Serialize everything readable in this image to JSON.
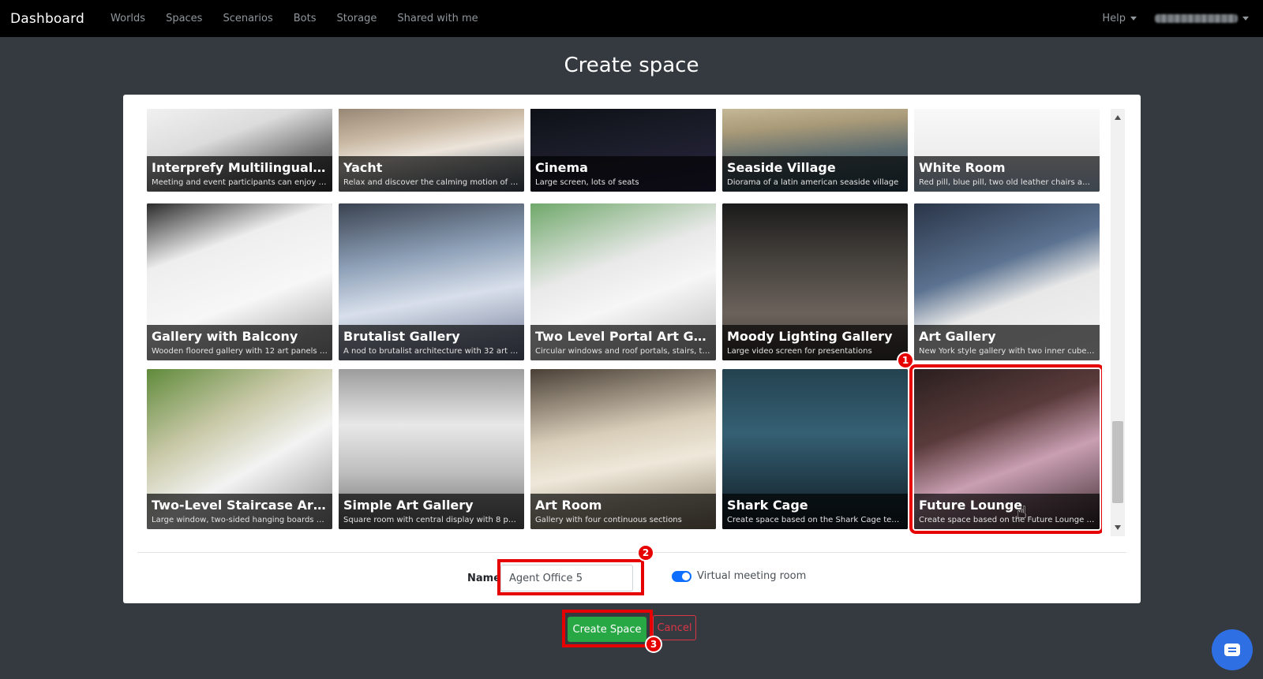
{
  "navbar": {
    "brand": "Dashboard",
    "links": [
      "Worlds",
      "Spaces",
      "Scenarios",
      "Bots",
      "Storage",
      "Shared with me"
    ],
    "help": "Help"
  },
  "page": {
    "title": "Create space"
  },
  "spaces": [
    {
      "title": "Interprefy Multilingual Con...",
      "desc": "Meeting and event participants can enjoy real-ti...",
      "thumb": "white-stage"
    },
    {
      "title": "Yacht",
      "desc": "Relax and discover the calming motion of floati...",
      "thumb": "yacht"
    },
    {
      "title": "Cinema",
      "desc": "Large screen, lots of seats",
      "thumb": "dark"
    },
    {
      "title": "Seaside Village",
      "desc": "Diorama of a latin american seaside village",
      "thumb": "seaside"
    },
    {
      "title": "White Room",
      "desc": "Red pill, blue pill, two old leather chairs and a vi...",
      "thumb": "white"
    },
    {
      "title": "Gallery with Balcony",
      "desc": "Wooden floored gallery with 12 art panels and r...",
      "thumb": "gallery-light"
    },
    {
      "title": "Brutalist Gallery",
      "desc": "A nod to brutalist architecture with 32 art panels",
      "thumb": "brutalist"
    },
    {
      "title": "Two Level Portal Art Gallery",
      "desc": "Circular windows and roof portals, stairs, two in...",
      "thumb": "portal"
    },
    {
      "title": "Moody Lighting Gallery",
      "desc": "Large video screen for presentations",
      "thumb": "moody"
    },
    {
      "title": "Art Gallery",
      "desc": "New York style gallery with two inner cube rooms",
      "thumb": "city"
    },
    {
      "title": "Two-Level Staircase Art Gal...",
      "desc": "Large window, two-sided hanging boards upstairs",
      "thumb": "staircase"
    },
    {
      "title": "Simple Art Gallery",
      "desc": "Square room with central display with 8 panels",
      "thumb": "simple"
    },
    {
      "title": "Art Room",
      "desc": "Gallery with four continuous sections",
      "thumb": "artroom"
    },
    {
      "title": "Shark Cage",
      "desc": "Create space based on the Shark Cage template",
      "thumb": "shark"
    },
    {
      "title": "Future Lounge",
      "desc": "Create space based on the Future Lounge templ...",
      "thumb": "lounge"
    }
  ],
  "form": {
    "name_label": "Name",
    "name_value": "Agent Office 5",
    "toggle_label": "Virtual meeting room",
    "toggle_on": true
  },
  "buttons": {
    "create": "Create Space",
    "cancel": "Cancel"
  },
  "annotations": [
    "1",
    "2",
    "3"
  ],
  "colors": {
    "accent": "#28a745",
    "danger": "#dc3545",
    "highlight": "#e60000",
    "toggle": "#0d6efd"
  }
}
